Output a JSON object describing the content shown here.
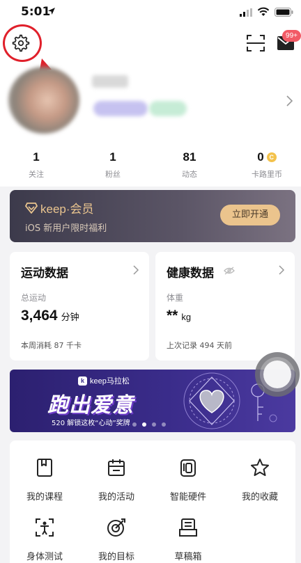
{
  "status_bar": {
    "time": "5:01"
  },
  "header": {
    "mail_badge": "99+"
  },
  "stats": [
    {
      "value": "1",
      "label": "关注"
    },
    {
      "value": "1",
      "label": "粉丝"
    },
    {
      "value": "81",
      "label": "动态"
    },
    {
      "value": "0",
      "label": "卡路里币",
      "coin_glyph": "C"
    }
  ],
  "membership": {
    "brand": "keep·会员",
    "subtitle": "iOS 新用户限时福利",
    "button_label": "立即开通"
  },
  "sports_card": {
    "title": "运动数据",
    "metric_label": "总运动",
    "value": "3,464",
    "unit": "分钟",
    "footer": "本周消耗 87 千卡"
  },
  "health_card": {
    "title": "健康数据",
    "metric_label": "体重",
    "value": "**",
    "unit": "kg",
    "footer": "上次记录 494 天前"
  },
  "promo": {
    "brand": "keep马拉松",
    "title": "跑出爱意",
    "subtitle": "520 解锁这枚“心动”奖牌",
    "dots_count": 4,
    "active_dot": 1
  },
  "menu": [
    {
      "label": "我的课程",
      "icon": "course-icon"
    },
    {
      "label": "我的活动",
      "icon": "calendar-icon"
    },
    {
      "label": "智能硬件",
      "icon": "smart-device-icon"
    },
    {
      "label": "我的收藏",
      "icon": "star-icon"
    },
    {
      "label": "身体测试",
      "icon": "body-test-icon"
    },
    {
      "label": "我的目标",
      "icon": "target-icon"
    },
    {
      "label": "草稿箱",
      "icon": "draft-box-icon"
    }
  ],
  "colors": {
    "highlight_ring": "#e0202b",
    "member_gold": "#ebc48d",
    "badge_red": "#f25b66",
    "promo_purple": "#3a2c8a"
  }
}
